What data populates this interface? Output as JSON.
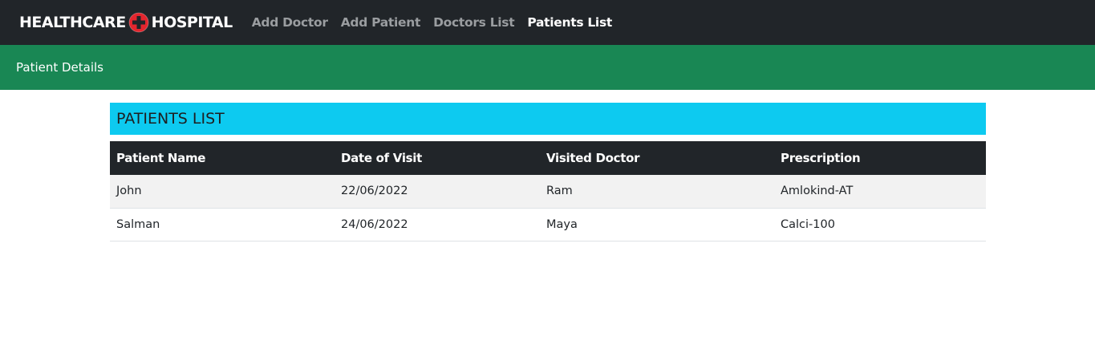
{
  "navbar": {
    "brand_left": "HEALTHCARE",
    "brand_right": "HOSPITAL",
    "brand_icon": "red-cross-icon",
    "links": [
      {
        "label": "Add Doctor",
        "active": false
      },
      {
        "label": "Add Patient",
        "active": false
      },
      {
        "label": "Doctors List",
        "active": false
      },
      {
        "label": "Patients List",
        "active": true
      }
    ]
  },
  "subheader": {
    "title": "Patient Details"
  },
  "patients": {
    "title": "PATIENTS LIST",
    "columns": [
      "Patient Name",
      "Date of Visit",
      "Visited Doctor",
      "Prescription"
    ],
    "rows": [
      [
        "John",
        "22/06/2022",
        "Ram",
        "Amlokind-AT"
      ],
      [
        "Salman",
        "24/06/2022",
        "Maya",
        "Calci-100"
      ]
    ]
  },
  "colors": {
    "navbar_bg": "#212529",
    "subheader_bg": "#198754",
    "list_header_bg": "#0dcaf0",
    "cross_red": "#e3262e"
  }
}
